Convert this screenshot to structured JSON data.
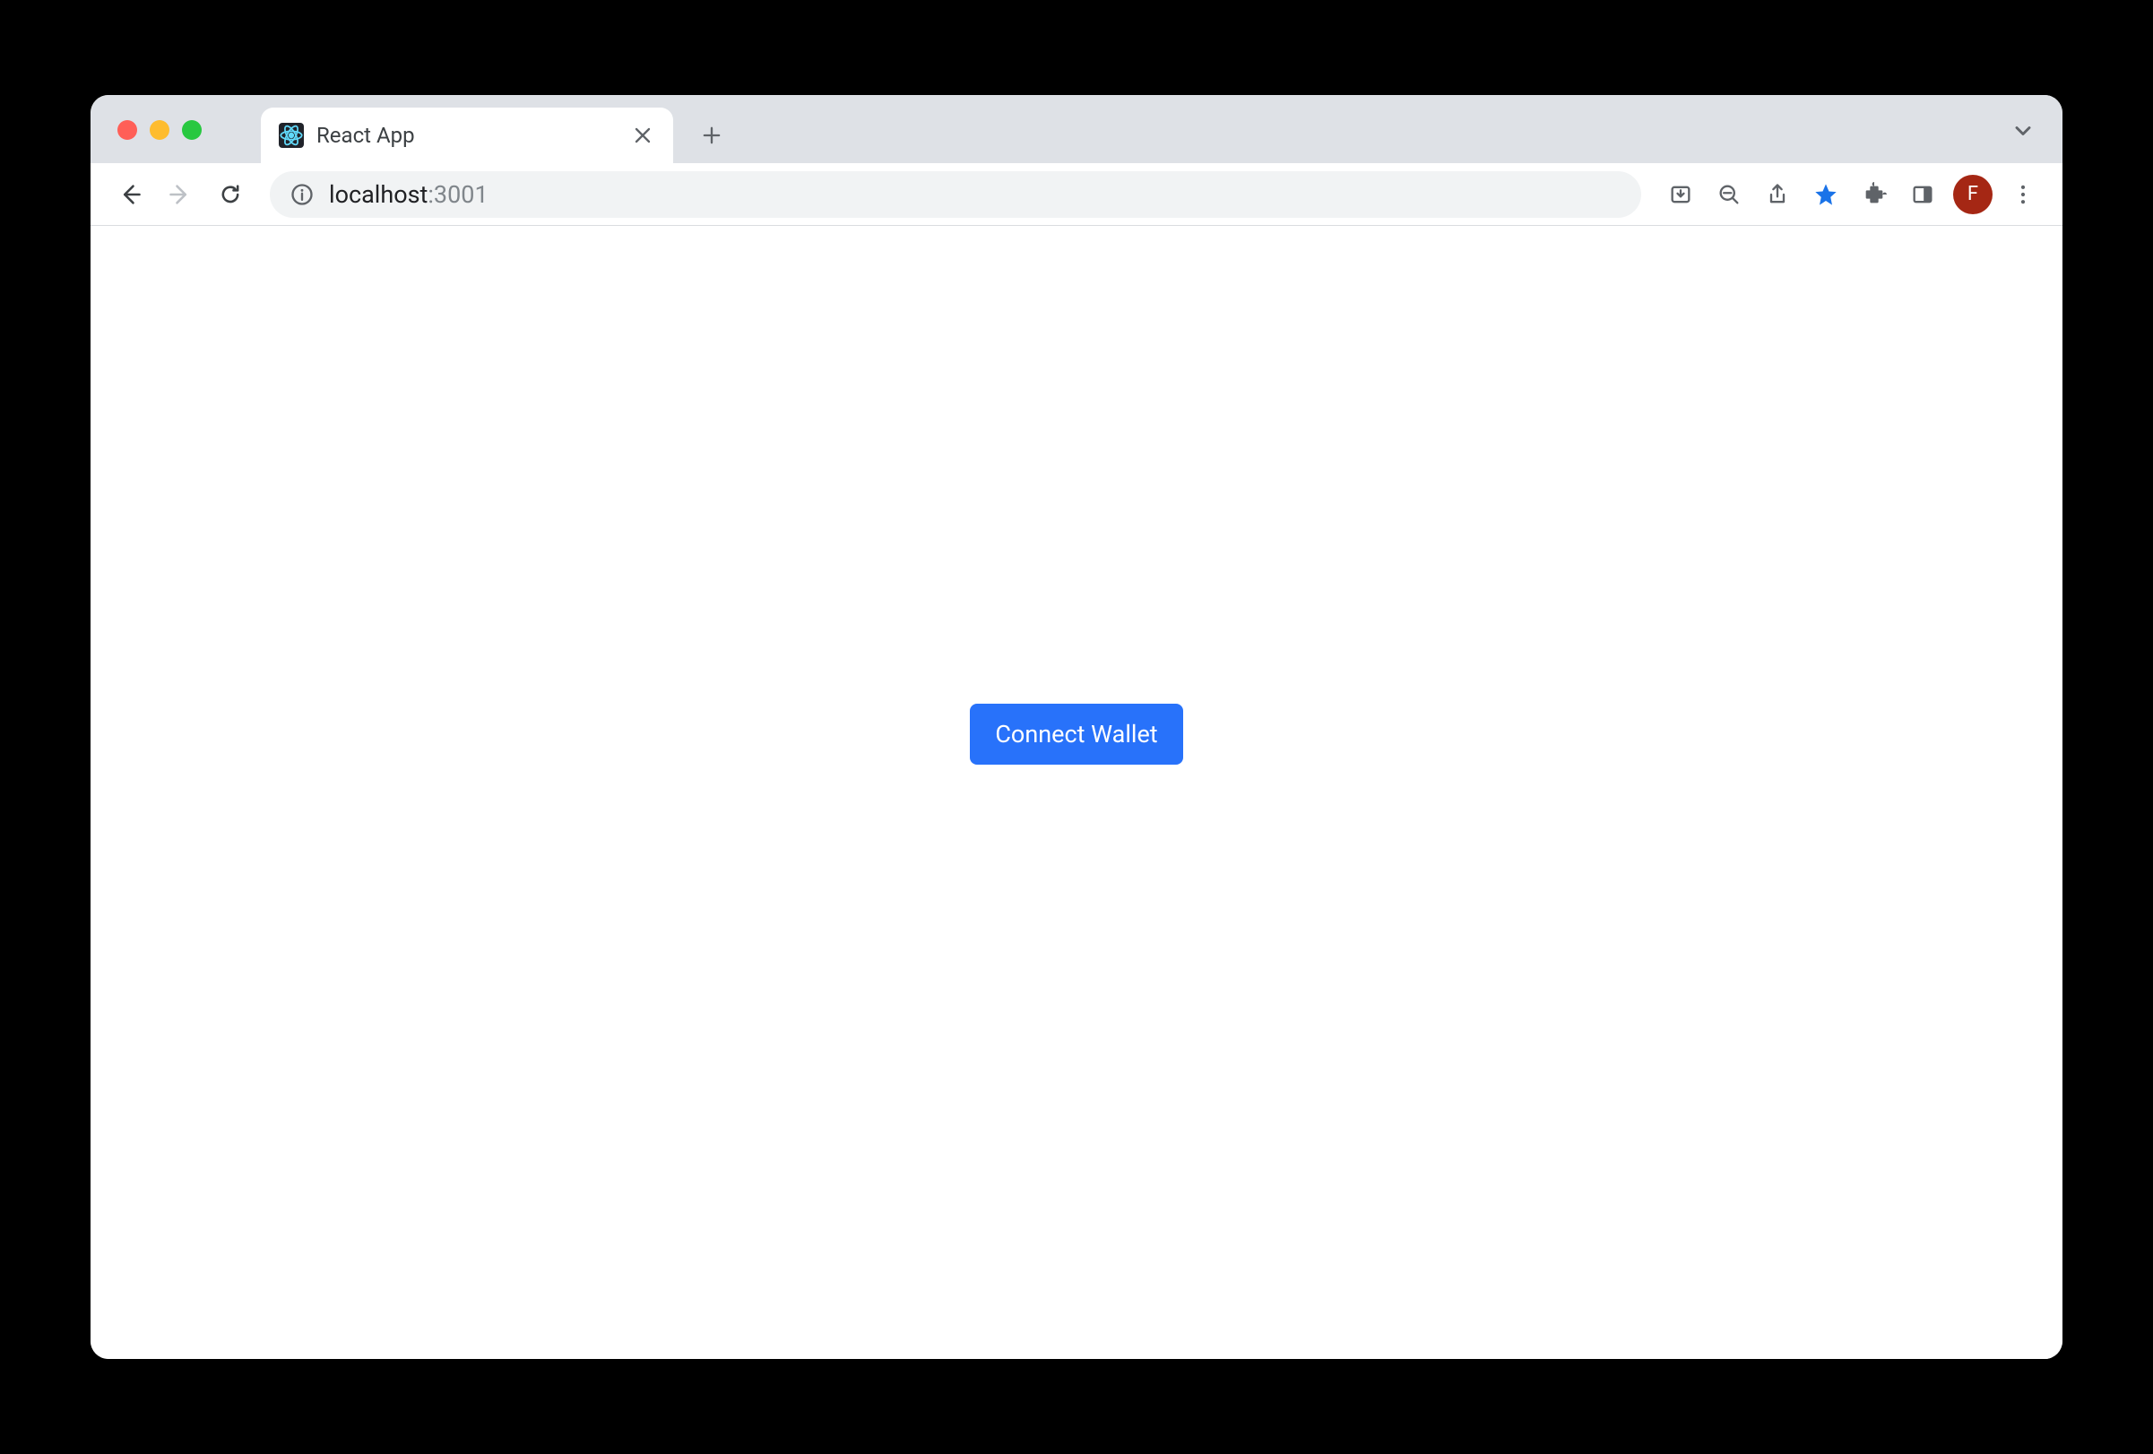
{
  "browser": {
    "tab": {
      "title": "React App"
    },
    "url": {
      "host": "localhost",
      "port": ":3001"
    },
    "profile": {
      "initial": "F"
    }
  },
  "page": {
    "connect_wallet_label": "Connect Wallet"
  }
}
